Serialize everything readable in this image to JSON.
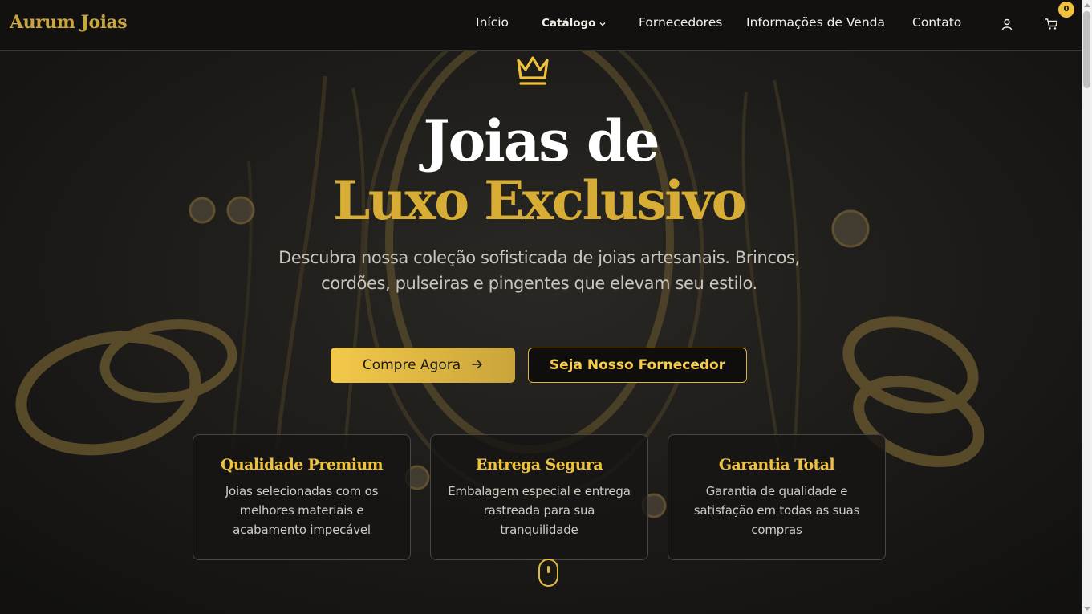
{
  "header": {
    "logo": "Aurum Joias",
    "nav": [
      {
        "label": "Início"
      },
      {
        "label": "Catálogo"
      },
      {
        "label": "Fornecedores"
      },
      {
        "label": "Informações de Venda"
      },
      {
        "label": "Contato"
      }
    ],
    "user_icon": "user-icon",
    "cart_icon": "cart-icon",
    "cart_count": "0"
  },
  "hero": {
    "icon": "crown-icon",
    "title_line1": "Joias de",
    "title_line2": "Luxo Exclusivo",
    "subtitle": "Descubra nossa coleção sofisticada de joias artesanais. Brincos, cordões, pulseiras e pingentes que elevam seu estilo.",
    "primary_button": "Compre Agora",
    "primary_button_icon": "arrow-right-icon",
    "secondary_button": "Seja Nosso Fornecedor",
    "scroll_indicator_icon": "mouse-scroll-icon"
  },
  "features": [
    {
      "title": "Qualidade Premium",
      "text": "Joias selecionadas com os melhores materiais e acabamento impecável"
    },
    {
      "title": "Entrega Segura",
      "text": "Embalagem especial e entrega rastreada para sua tranquilidade"
    },
    {
      "title": "Garantia Total",
      "text": "Garantia de qualidade e satisfação em todas as suas compras"
    }
  ],
  "colors": {
    "accent_gold": "#d8ad35",
    "button_gold": "#f3c94a",
    "background": "#181716",
    "header_bg": "#121110"
  }
}
